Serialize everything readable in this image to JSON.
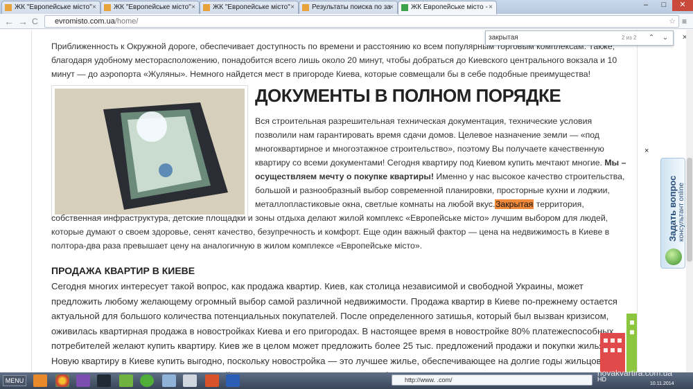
{
  "tabs": [
    {
      "title": "ЖК \"Европейське місто\"",
      "color": "#e8a23a"
    },
    {
      "title": "ЖК \"Европейське місто\"",
      "color": "#e8a23a"
    },
    {
      "title": "ЖК \"Европейське місто\"",
      "color": "#e8a23a"
    },
    {
      "title": "Результаты поиска по за",
      "color": "#e8a23a"
    },
    {
      "title": "ЖК Европейське місто -",
      "color": "#3fa34d"
    }
  ],
  "window": {
    "minimize": "–",
    "maximize": "□",
    "close": "✕"
  },
  "toolbar": {
    "back": "←",
    "forward": "→",
    "reload": "C"
  },
  "address": {
    "host": "evromisto.com.ua",
    "path": "/home/"
  },
  "find": {
    "query": "закрытая",
    "count": "2 из 2",
    "prev": "⌃",
    "next": "⌄",
    "close": "✕"
  },
  "content": {
    "intro": "Приближенность к Окружной дороге, обеспечивает доступность по времени и расстоянию ко всем популярным торговым комплексам. Также, благодаря удобному месторасположению, понадобится всего лишь около 20 минут, чтобы добраться до Киевского центрального вокзала и 10 минут — до аэропорта «Жуляны». Немного найдется мест в пригороде Киева, которые совмещали бы в себе подобные преимущества!",
    "h1": "ДОКУМЕНТЫ В ПОЛНОМ ПОРЯДКЕ",
    "p1a": "Вся строительная разрешительная техническая документация, технические условия позволили нам гарантировать время сдачи домов. Целевое назначение земли — «под многоквартирное и многоэтажное строительство», поэтому Вы получаете качественную квартиру со всеми документами! Сегодня квартиру под Киевом купить мечтают многие.",
    "p1b": "Мы – осуществляем мечту о покупке квартиры!",
    "p1c": "Именно у нас высокое качество строительства, большой и разнообразный выбор современной планировки, просторные кухни и лоджии, металлопластиковые окна, светлые комнаты на любой вкус.",
    "p1hl": "Закрытая",
    "p1d": "территория, собственная инфраструктура, детские площадки и зоны отдыха делают жилой комплекс «Европейське місто» лучшим выбором для людей, которые думают о своем здоровье, сенят качество, безупречность и комфорт. Еще один важный фактор — цена на недвижимость в Киеве в полтора-два раза превышает цену на аналогичную в жилом комплексе «Европейське місто».",
    "h2": "ПРОДАЖА КВАРТИР В КИЕВЕ",
    "p2": "Сегодня многих интересует такой вопрос, как продажа квартир. Киев, как столица независимой и свободной Украины, может предложить любому желающему огромный выбор самой различной недвижимости. Продажа квартир в Киеве по-прежнему остается актуальной для большого количества потенциальных покупателей. После определенного затишья, который был вызван кризисом, оживилась квартирная продажа в новостройках Киева и его пригородах. В настоящее время в новостройке 80% платежеспособных потребителей желают купить квартиру. Киев же в целом может предложить более 25 тыс. предложений продажи и покупки жилья. Новую квартиру в Киеве купить выгодно, поскольку новостройка — это лучшее жилье, обеспечивающее на долгие годы жильцов возможностью не производить ежегодный ремонт, жить в свое удовольствие, без"
  },
  "close_mark": "×",
  "side_widget": {
    "line1": "Задать вопрос",
    "line2": "консультант online"
  },
  "taskbar": {
    "menu": "MENU",
    "address": "http://www. .com/",
    "watermark": "novakvartira.com.ua",
    "lang": "HD",
    "date": "10.11.2014"
  }
}
